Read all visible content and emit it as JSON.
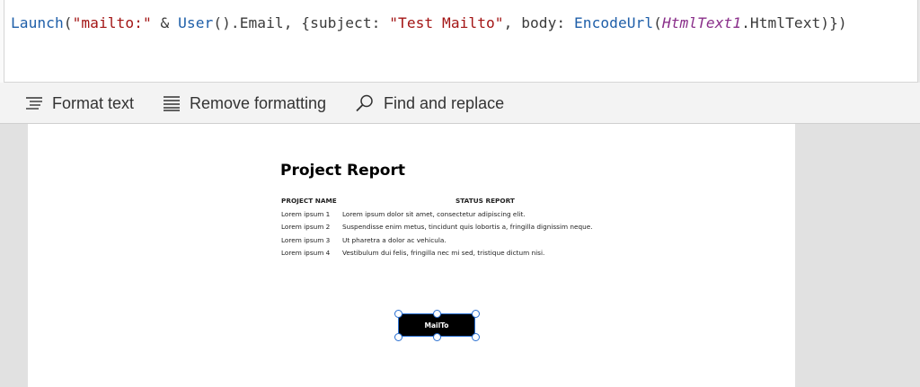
{
  "formula_bar": {
    "tokens": [
      {
        "text": "Launch",
        "kind": "fn"
      },
      {
        "text": "(",
        "kind": "plain"
      },
      {
        "text": "\"mailto:\"",
        "kind": "str"
      },
      {
        "text": " & ",
        "kind": "plain"
      },
      {
        "text": "User",
        "kind": "fn"
      },
      {
        "text": "().Email, {subject: ",
        "kind": "plain"
      },
      {
        "text": "\"Test Mailto\"",
        "kind": "str"
      },
      {
        "text": ", body: ",
        "kind": "plain"
      },
      {
        "text": "EncodeUrl",
        "kind": "fn"
      },
      {
        "text": "(",
        "kind": "plain"
      },
      {
        "text": "HtmlText1",
        "kind": "var"
      },
      {
        "text": ".HtmlText)})",
        "kind": "plain"
      }
    ]
  },
  "toolbar": {
    "format_text": {
      "label": "Format text",
      "icon": "format-lines-icon"
    },
    "remove_formatting": {
      "label": "Remove formatting",
      "icon": "remove-format-icon"
    },
    "find_replace": {
      "label": "Find and replace",
      "icon": "search-icon"
    }
  },
  "report": {
    "title": "Project Report",
    "headers": {
      "name": "PROJECT NAME",
      "status": "STATUS REPORT"
    },
    "rows": [
      {
        "name": "Lorem ipsum 1",
        "status": "Lorem ipsum dolor sit amet, consectetur adipiscing elit."
      },
      {
        "name": "Lorem ipsum 2",
        "status": "Suspendisse enim metus, tincidunt quis lobortis a, fringilla dignissim neque."
      },
      {
        "name": "Lorem ipsum 3",
        "status": "Ut pharetra a dolor ac vehicula."
      },
      {
        "name": "Lorem ipsum 4",
        "status": "Vestibulum dui felis, fringilla nec mi sed, tristique dictum nisi."
      }
    ]
  },
  "mailto_button": {
    "label": "MailTo"
  },
  "colors": {
    "function": "#1f5fa9",
    "string": "#a31515",
    "variable": "#8a2f8a",
    "selection": "#2a6fd0",
    "button_bg": "#000000"
  }
}
